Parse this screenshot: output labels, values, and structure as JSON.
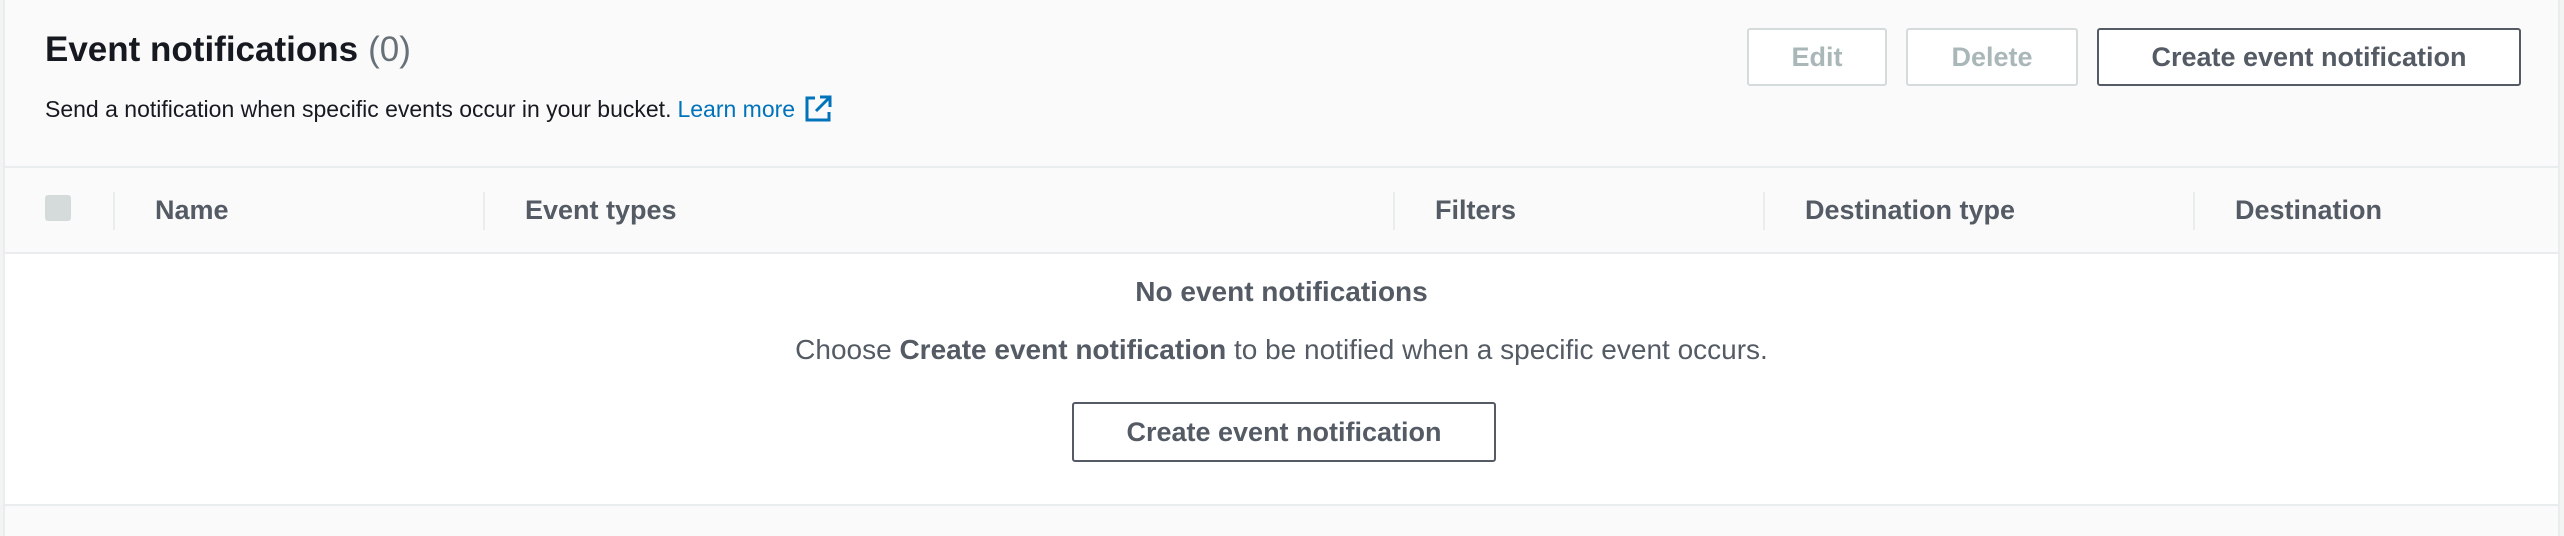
{
  "header": {
    "title": "Event notifications",
    "count": "(0)",
    "description": "Send a notification when specific events occur in your bucket.",
    "learn_more": "Learn more",
    "external_icon": "external-link-icon"
  },
  "toolbar": {
    "edit_label": "Edit",
    "delete_label": "Delete",
    "create_label": "Create event notification"
  },
  "table": {
    "columns": [
      "Name",
      "Event types",
      "Filters",
      "Destination type",
      "Destination"
    ]
  },
  "empty_state": {
    "title": "No event notifications",
    "desc_prefix": "Choose ",
    "desc_bold": "Create event notification",
    "desc_suffix": " to be notified when a specific event occurs.",
    "button_label": "Create event notification"
  },
  "colors": {
    "link": "#0073bb",
    "text": "#16191f",
    "muted": "#545b64",
    "disabled": "#aab7b8",
    "border": "#eaeded"
  }
}
